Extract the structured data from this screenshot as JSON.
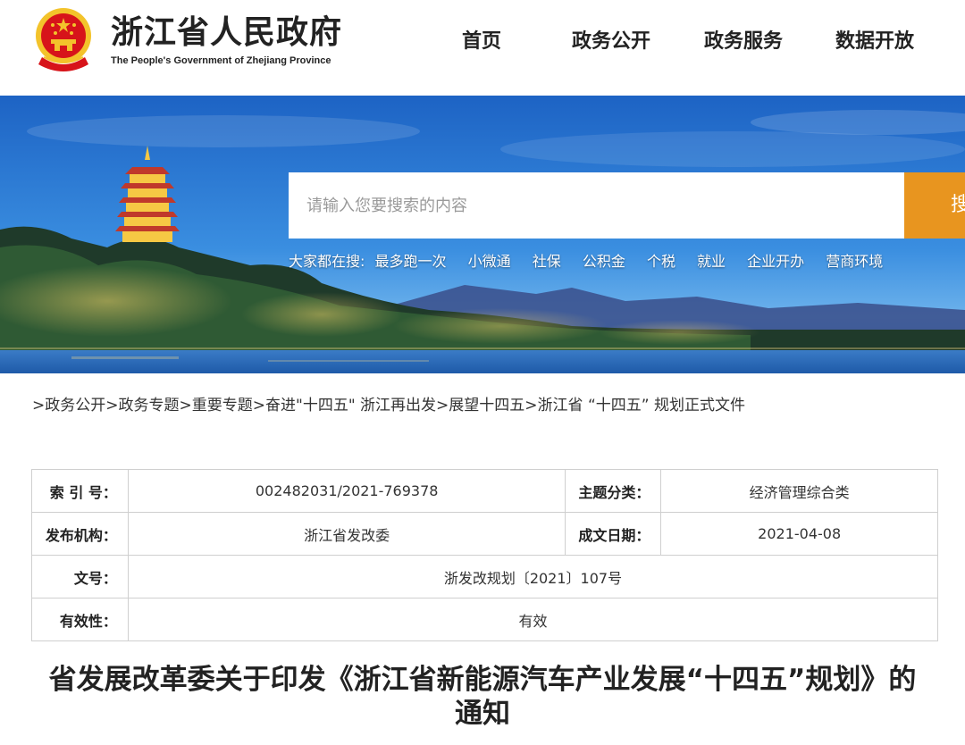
{
  "header": {
    "title": "浙江省人民政府",
    "subtitle": "The People's Government of Zhejiang Province",
    "nav": [
      "首页",
      "政务公开",
      "政务服务",
      "数据开放"
    ]
  },
  "search": {
    "placeholder": "请输入您要搜索的内容",
    "button_label": "搜",
    "hot_label": "大家都在搜:",
    "hot_terms": [
      "最多跑一次",
      "小微通",
      "社保",
      "公积金",
      "个税",
      "就业",
      "企业开办",
      "营商环境"
    ]
  },
  "breadcrumb": {
    "items": [
      "政务公开",
      "政务专题",
      "重要专题",
      "奋进\"十四五\" 浙江再出发",
      "展望十四五",
      "浙江省 “十四五” 规划正式文件"
    ]
  },
  "info": {
    "index_label": "索 引 号：",
    "index_value": "002482031/2021-769378",
    "topic_label": "主题分类：",
    "topic_value": "经济管理综合类",
    "publisher_label": "发布机构：",
    "publisher_value": "浙江省发改委",
    "date_label": "成文日期：",
    "date_value": "2021-04-08",
    "doc_no_label": "文号：",
    "doc_no_value": "浙发改规划〔2021〕107号",
    "validity_label": "有效性：",
    "validity_value": "有效"
  },
  "article": {
    "title": "省发展改革委关于印发《浙江省新能源汽车产业发展“十四五”规划》的通知"
  },
  "colors": {
    "accent": "#e8951f",
    "emblem_red": "#d7141a",
    "emblem_gold": "#f3c32b"
  }
}
